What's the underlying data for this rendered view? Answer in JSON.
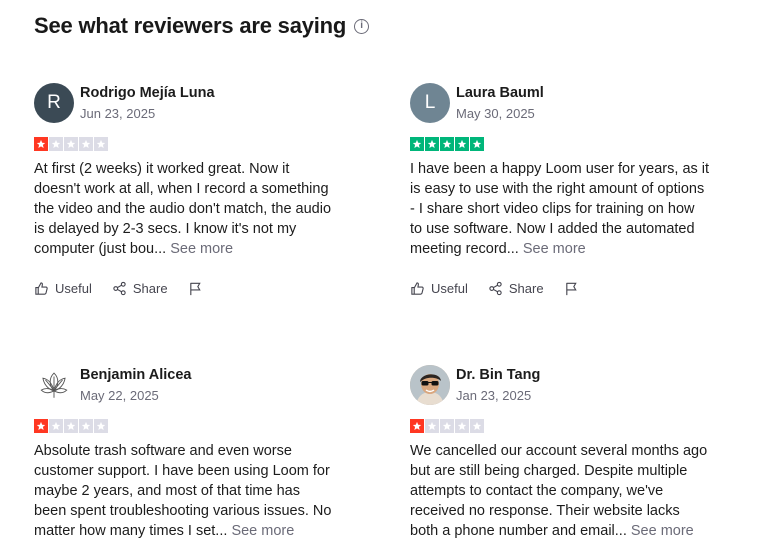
{
  "section": {
    "title": "See what reviewers are saying",
    "info_icon": "info-icon"
  },
  "reviews": [
    {
      "author": "Rodrigo Mejía Luna",
      "avatar_initial": "R",
      "date": "Jun 23, 2025",
      "rating": 1,
      "text": "At first (2 weeks) it worked great. Now it doesn't work at all, when I record a something the video and the audio don't match, the audio is delayed by 2-3 secs. I know it's not my computer (just bou...",
      "see_more": "See more",
      "useful": "Useful",
      "share": "Share"
    },
    {
      "author": "Laura Bauml",
      "avatar_initial": "L",
      "date": "May 30, 2025",
      "rating": 5,
      "text": "I have been a happy Loom user for years, as it is easy to use with the right amount of options - I share short video clips for training on how to use software. Now I added the automated meeting record...",
      "see_more": "See more",
      "useful": "Useful",
      "share": "Share"
    },
    {
      "author": "Benjamin Alicea",
      "date": "May 22, 2025",
      "rating": 1,
      "text": "Absolute trash software and even worse customer support. I have been using Loom for maybe 2 years, and most of that time has been spent troubleshooting various issues. No matter how many times I set...",
      "see_more": "See more"
    },
    {
      "author": "Dr. Bin Tang",
      "date": "Jan 23, 2025",
      "rating": 1,
      "text": "We cancelled our account several months ago but are still being charged. Despite multiple attempts to contact the company, we've received no response. Their website lacks both a phone number and email...",
      "see_more": "See more"
    }
  ],
  "colors": {
    "star_red": "#ff3722",
    "star_green": "#00b67a",
    "star_empty": "#dcdce6",
    "muted": "#6b6b78"
  }
}
